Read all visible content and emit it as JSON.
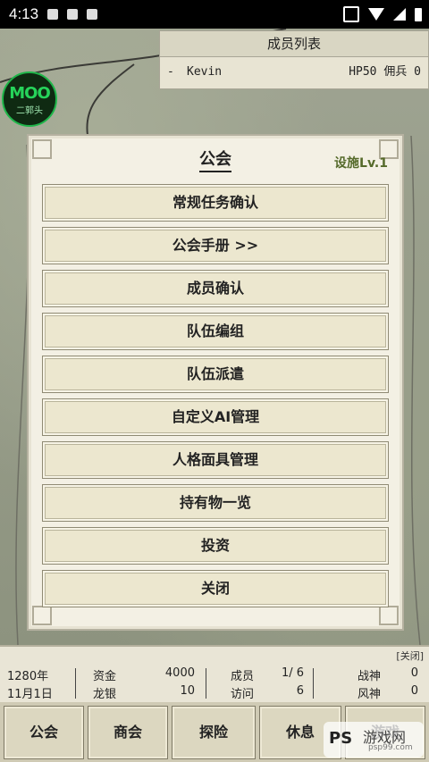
{
  "status_bar": {
    "time": "4:13"
  },
  "logo": {
    "top": "MOO",
    "bottom": "二郭头"
  },
  "member_list": {
    "title": "成员列表",
    "rows": [
      {
        "dash": "-",
        "name": "Kevin",
        "stat": "HP50 佣兵  0"
      }
    ]
  },
  "dialog": {
    "title": "公会",
    "facility": "设施Lv.1",
    "buttons": [
      "常规任务确认",
      "公会手册 >>",
      "成员确认",
      "队伍编组",
      "队伍派遣",
      "自定义AI管理",
      "人格面具管理",
      "持有物一览",
      "投资",
      "关闭"
    ]
  },
  "info": {
    "close_tag": "[关闭]",
    "year": "1280年",
    "date": "11月1日",
    "funds_label": "资金",
    "funds_value": "4000",
    "dragon_label": "龙银",
    "dragon_value": "10",
    "members_label": "成员",
    "members_value": "1/ 6",
    "visit_label": "访问",
    "visit_value": "6",
    "war_god_label": "战神",
    "war_god_value": "0",
    "wind_god_label": "风神",
    "wind_god_value": "0"
  },
  "nav": [
    "公会",
    "商会",
    "探险",
    "休息",
    "游戏"
  ],
  "watermark": {
    "ps": "PS",
    "text": "游戏网",
    "url": "psp99.com"
  }
}
